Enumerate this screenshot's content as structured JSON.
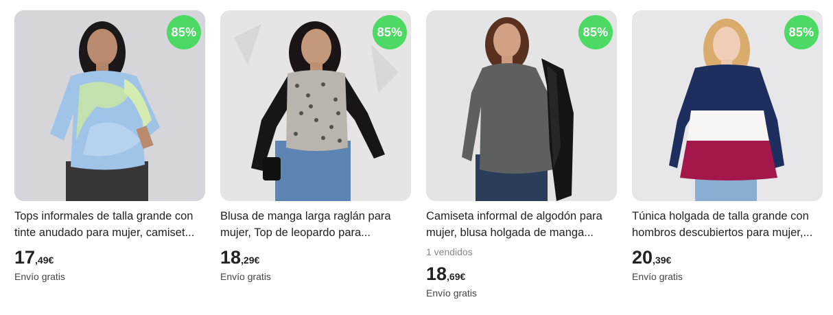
{
  "accent": {
    "badge_color": "#4cd964"
  },
  "products": [
    {
      "discount": "85%",
      "title": "Tops informales de talla grande con tinte anudado para mujer, camiset...",
      "sold": "",
      "price_int": "17",
      "price_dec": ",49€",
      "shipping": "Envío gratis"
    },
    {
      "discount": "85%",
      "title": "Blusa de manga larga raglán para mujer, Top de leopardo para...",
      "sold": "",
      "price_int": "18",
      "price_dec": ",29€",
      "shipping": "Envío gratis"
    },
    {
      "discount": "85%",
      "title": "Camiseta informal de algodón para mujer, blusa holgada de manga...",
      "sold": "1 vendidos",
      "price_int": "18",
      "price_dec": ",69€",
      "shipping": "Envío gratis"
    },
    {
      "discount": "85%",
      "title": "Túnica holgada de talla grande con hombros descubiertos para mujer,...",
      "sold": "",
      "price_int": "20",
      "price_dec": ",39€",
      "shipping": "Envío gratis"
    }
  ]
}
